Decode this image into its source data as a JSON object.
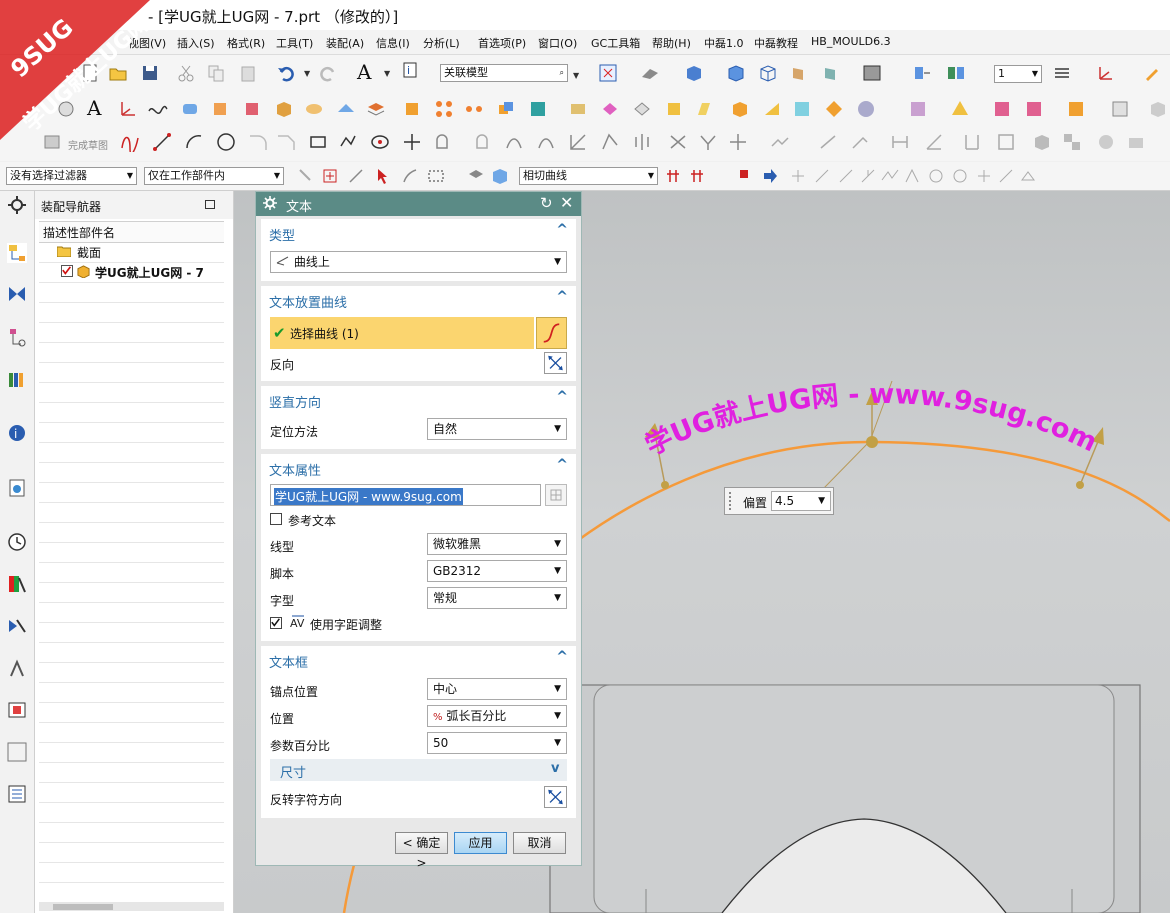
{
  "window": {
    "title": "- [学UG就上UG网 - 7.prt （修改的）]"
  },
  "watermark": {
    "line1": "9SUG",
    "line2": "学UG就上UG网"
  },
  "menu": [
    "视图(V)",
    "插入(S)",
    "格式(R)",
    "工具(T)",
    "装配(A)",
    "信息(I)",
    "分析(L)",
    "首选项(P)",
    "窗口(O)",
    "GC工具箱",
    "帮助(H)",
    "中磊1.0",
    "中磊教程",
    "HB_MOULD6.3"
  ],
  "toolbar1": {
    "model_combo": "关联模型",
    "layer_combo": "1"
  },
  "toolbar3": {
    "finish_sketch": "完成草图"
  },
  "selbar": {
    "filter": "没有选择过滤器",
    "scope": "仅在工作部件内",
    "curve_rule": "相切曲线"
  },
  "navigator": {
    "title": "装配导航器",
    "column": "描述性部件名",
    "items": [
      {
        "label": "截面"
      },
      {
        "label": "学UG就上UG网 - 7"
      }
    ]
  },
  "dialog": {
    "title": "文本",
    "type_section": {
      "title": "类型",
      "value": "曲线上"
    },
    "curve_section": {
      "title": "文本放置曲线",
      "select_label": "选择曲线 (1)",
      "reverse_label": "反向"
    },
    "vertical_section": {
      "title": "竖直方向",
      "method_label": "定位方法",
      "method_value": "自然"
    },
    "props_section": {
      "title": "文本属性",
      "text_value": "学UG就上UG网 - www.9sug.com",
      "ref_text_label": "参考文本",
      "line_type_label": "线型",
      "line_type_value": "微软雅黑",
      "script_label": "脚本",
      "script_value": "GB2312",
      "font_style_label": "字型",
      "font_style_value": "常规",
      "kerning_label": "使用字距调整"
    },
    "frame_section": {
      "title": "文本框",
      "anchor_label": "锚点位置",
      "anchor_value": "中心",
      "position_label": "位置",
      "position_value": "弧长百分比",
      "param_label": "参数百分比",
      "param_value": "50",
      "size_title": "尺寸",
      "flip_label": "反转字符方向"
    },
    "buttons": {
      "ok": "< 确定 >",
      "apply": "应用",
      "cancel": "取消"
    }
  },
  "canvas": {
    "text_on_curve": "学UG就上UG网 - www.9sug.com",
    "offset_label": "偏置",
    "offset_value": "4.5"
  },
  "colors": {
    "accent": "#2c6fa8",
    "dialog_header": "#5b8b86",
    "selection": "#fbd56f",
    "curve": "#f59a3a",
    "text_on_curve": "#e020e0"
  }
}
